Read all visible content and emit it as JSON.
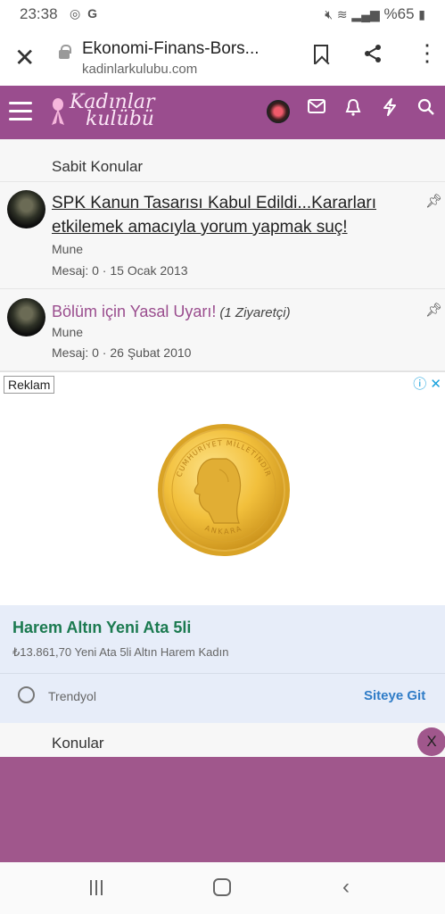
{
  "status": {
    "time": "23:38",
    "battery": "%65",
    "icons": [
      "instagram-icon",
      "g-icon"
    ]
  },
  "browser": {
    "title": "Ekonomi-Finans-Bors...",
    "domain": "kadinlarkulubu.com"
  },
  "site": {
    "logo_line1": "Kadınlar",
    "logo_line2": "kulübü",
    "accent": "#9a4d8e"
  },
  "sticky": {
    "heading": "Sabit Konular",
    "topics": [
      {
        "title": "SPK Kanun Tasarısı Kabul Edildi...Kararları etkilemek amacıyla yorum yapmak suç!",
        "author": "Mune",
        "meta": "Mesaj: 0 · 15 Ocak 2013"
      },
      {
        "title": "Bölüm için Yasal Uyarı!",
        "visitors": "(1 Ziyaretçi)",
        "author": "Mune",
        "meta": "Mesaj: 0 · 26 Şubat 2010"
      }
    ]
  },
  "ad": {
    "label": "Reklam",
    "coin_top": "CUMHURİYET MİLLETİNDİR",
    "coin_bottom": "ANKARA",
    "product_name": "Harem Altın Yeni Ata 5li",
    "product_desc": "₺13.861,70 Yeni Ata 5li Altın Harem Kadın",
    "store": "Trendyol",
    "cta": "Siteye Git"
  },
  "topics_heading": "Konular",
  "close_label": "X"
}
